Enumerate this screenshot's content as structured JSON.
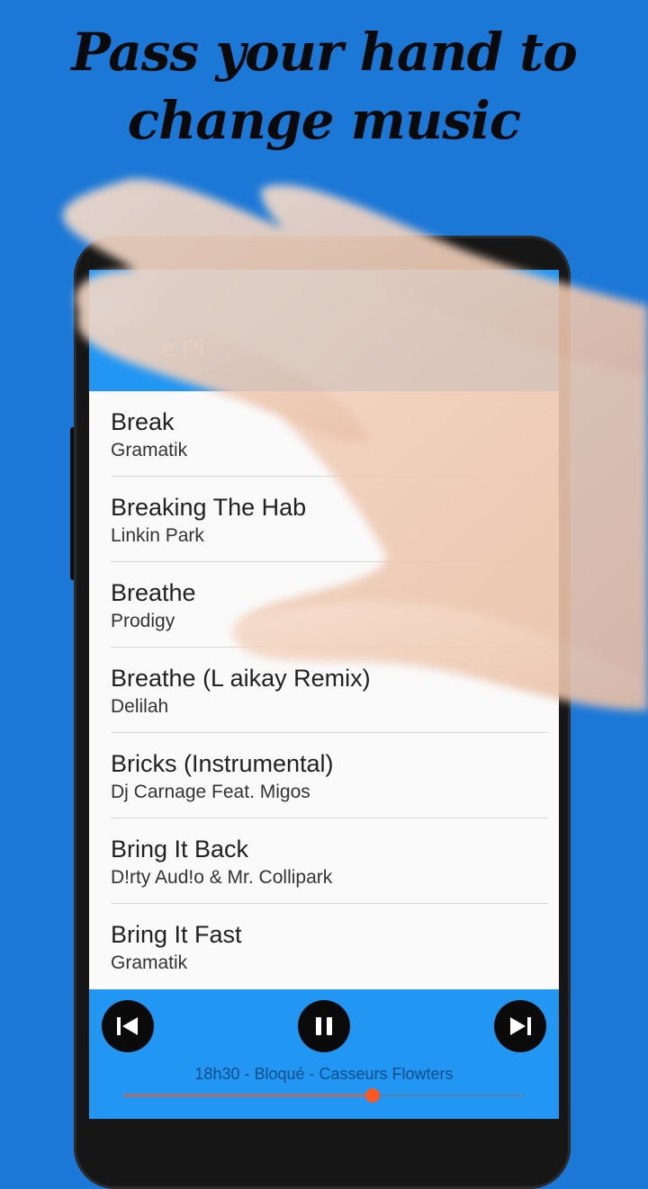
{
  "headline": {
    "line1": "Pass your hand to",
    "line2": "change music"
  },
  "app": {
    "title": "e Pl",
    "accent_color": "#2196f3",
    "background_color": "#1b78d6"
  },
  "songs": [
    {
      "title": "Break",
      "artist": "Gramatik"
    },
    {
      "title": "Breaking The Hab",
      "artist": "Linkin Park"
    },
    {
      "title": "Breathe",
      "artist": "Prodigy"
    },
    {
      "title": "Breathe (L   aikay Remix)",
      "artist": "Delilah"
    },
    {
      "title": "Bricks (Instrumental)",
      "artist": "Dj Carnage Feat. Migos"
    },
    {
      "title": "Bring It Back",
      "artist": "D!rty Aud!o & Mr. Collipark"
    },
    {
      "title": "Bring It Fast",
      "artist": "Gramatik"
    }
  ],
  "player": {
    "now_playing": "18h30 - Bloqué - Casseurs Flowters",
    "progress": 0.62,
    "previous_icon": "skip-previous-icon",
    "pause_icon": "pause-icon",
    "next_icon": "skip-next-icon",
    "progress_color": "#ff5722"
  }
}
